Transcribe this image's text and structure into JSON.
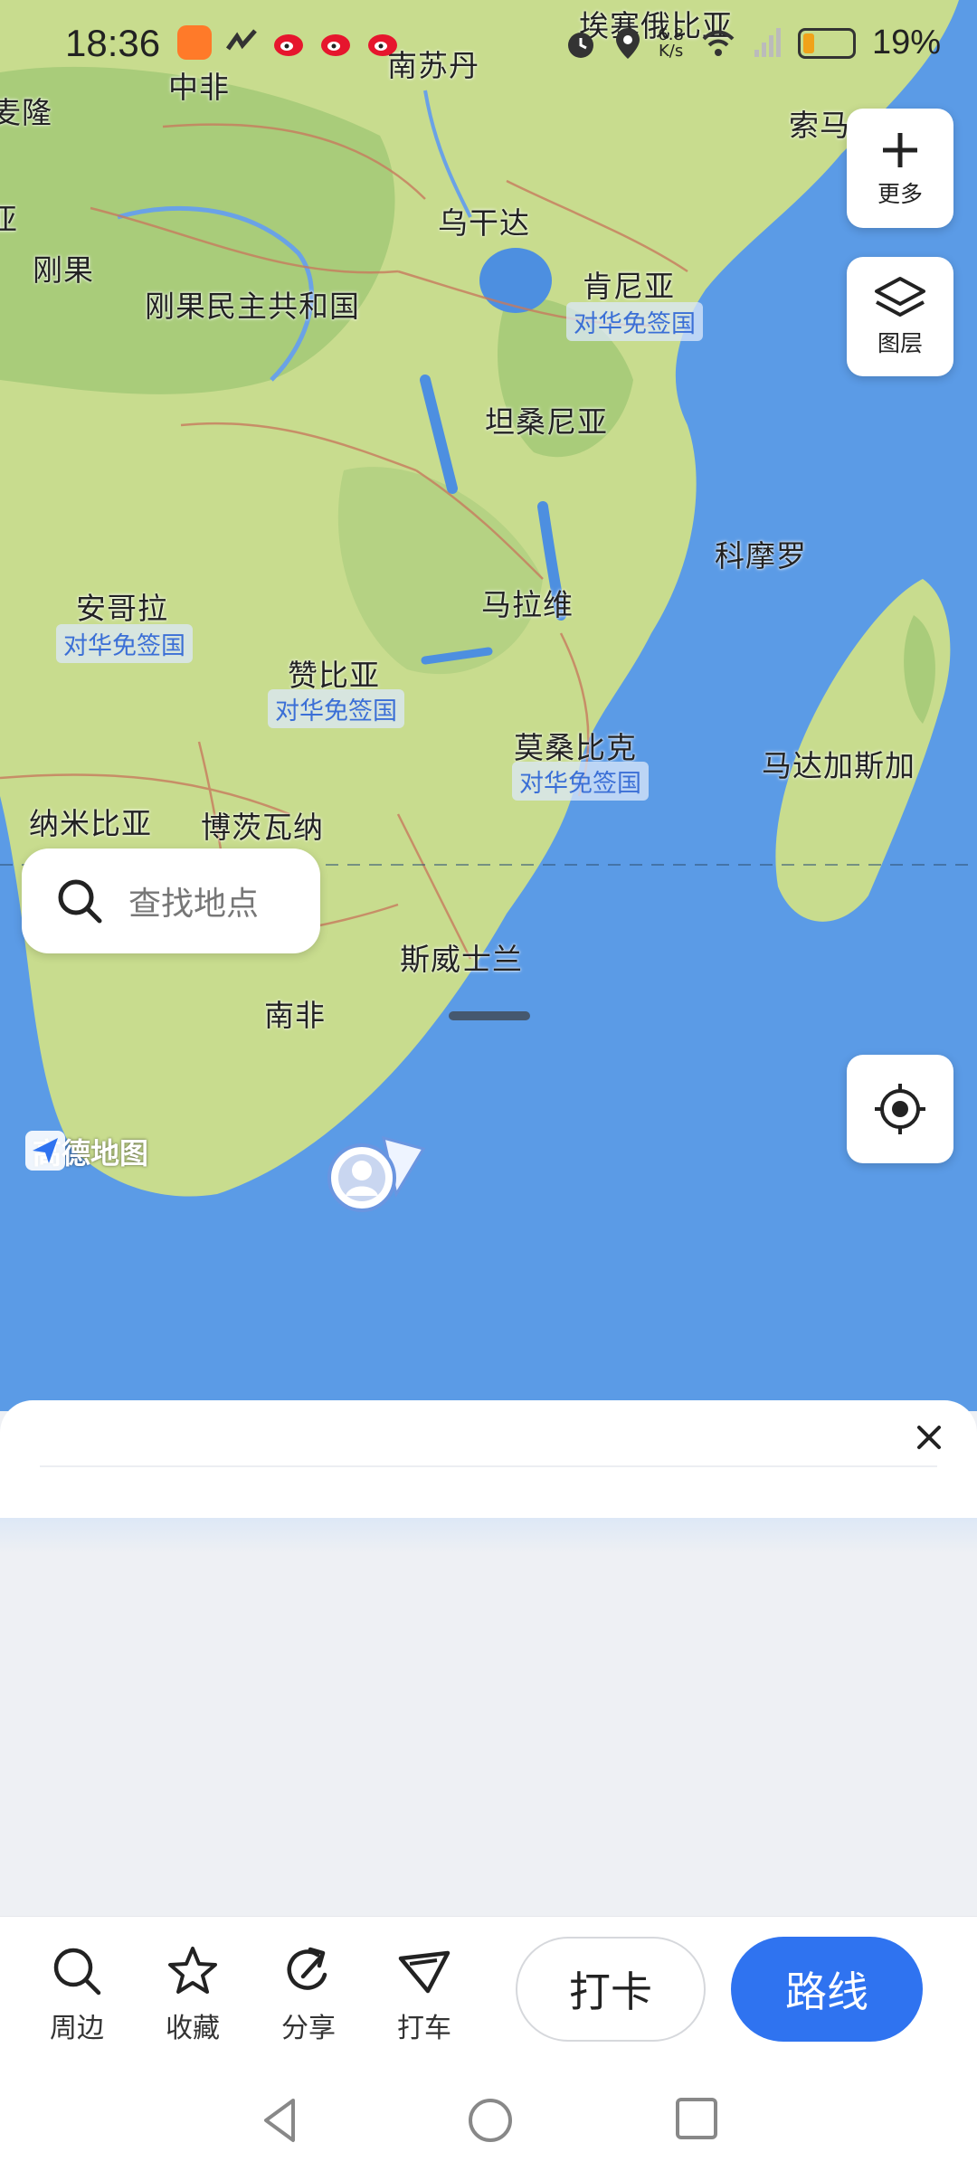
{
  "status_bar": {
    "time": "18:36",
    "network_speed_value": "6.8",
    "network_speed_unit": "K/s",
    "battery_percent": "19%",
    "colors": {
      "battery": "#f0a21a",
      "weibo": "#e6162d",
      "notify": "#ff7a29"
    }
  },
  "map": {
    "colors": {
      "ocean": "#5b9be6",
      "land": "#c8dc8e",
      "forest": "#a9cc7a",
      "lake": "#4d8fe0",
      "border": "#c77b5e"
    },
    "countries": [
      {
        "id": "ethiopia",
        "name": "埃塞俄比亚"
      },
      {
        "id": "car",
        "name": "中非"
      },
      {
        "id": "sudan-s",
        "name": "南苏丹"
      },
      {
        "id": "somalia",
        "name": "索马"
      },
      {
        "id": "gabon-partial",
        "name": "麦隆"
      },
      {
        "id": "uganda",
        "name": "乌干达"
      },
      {
        "id": "gabon",
        "name": "亚"
      },
      {
        "id": "congo",
        "name": "刚果"
      },
      {
        "id": "drc",
        "name": "刚果民主共和国"
      },
      {
        "id": "kenya",
        "name": "肯尼亚"
      },
      {
        "id": "tanzania",
        "name": "坦桑尼亚"
      },
      {
        "id": "comoros",
        "name": "科摩罗"
      },
      {
        "id": "angola",
        "name": "安哥拉"
      },
      {
        "id": "malawi",
        "name": "马拉维"
      },
      {
        "id": "zambia",
        "name": "赞比亚"
      },
      {
        "id": "mozambique",
        "name": "莫桑比克"
      },
      {
        "id": "madagascar",
        "name": "马达加斯加"
      },
      {
        "id": "namibia",
        "name": "纳米比亚"
      },
      {
        "id": "botswana",
        "name": "博茨瓦纳"
      },
      {
        "id": "eswatini",
        "name": "斯威士兰"
      },
      {
        "id": "south-africa",
        "name": "南非"
      }
    ],
    "visa_free_tag": "对华免签国",
    "brand_logo_text": "高德地图"
  },
  "controls": {
    "more_label": "更多",
    "layers_label": "图层",
    "search_placeholder": "查找地点"
  },
  "bottom_bar": {
    "items": [
      {
        "label": "周边",
        "icon": "search-icon"
      },
      {
        "label": "收藏",
        "icon": "star-icon"
      },
      {
        "label": "分享",
        "icon": "share-icon"
      },
      {
        "label": "打车",
        "icon": "taxi-icon"
      }
    ],
    "checkin_label": "打卡",
    "route_label": "路线",
    "colors": {
      "route_button": "#2f73f0"
    }
  }
}
